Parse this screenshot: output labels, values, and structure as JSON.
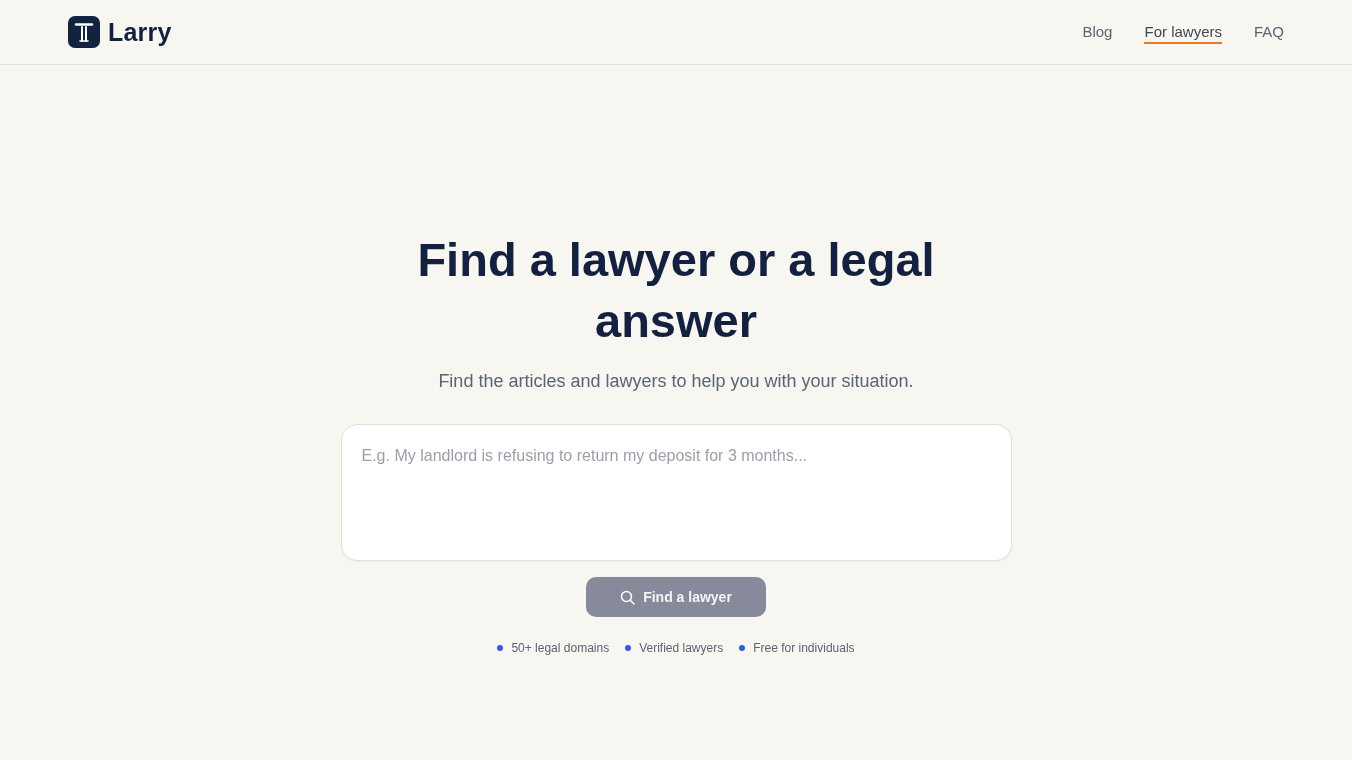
{
  "header": {
    "logo": {
      "text": "Larry"
    },
    "nav": [
      {
        "label": "Blog",
        "selected": false
      },
      {
        "label": "For lawyers",
        "selected": true
      },
      {
        "label": "FAQ",
        "selected": false
      }
    ]
  },
  "hero": {
    "title": "Find a lawyer or a legal answer",
    "subtitle": "Find the articles and lawyers to help you with your situation.",
    "query": {
      "placeholder": "E.g. My landlord is refusing to return my deposit for 3 months..."
    },
    "submit": {
      "label": "Find a lawyer",
      "disabled": true
    },
    "features": [
      "50+ legal domains",
      "Verified lawyers",
      "Free for individuals"
    ]
  }
}
